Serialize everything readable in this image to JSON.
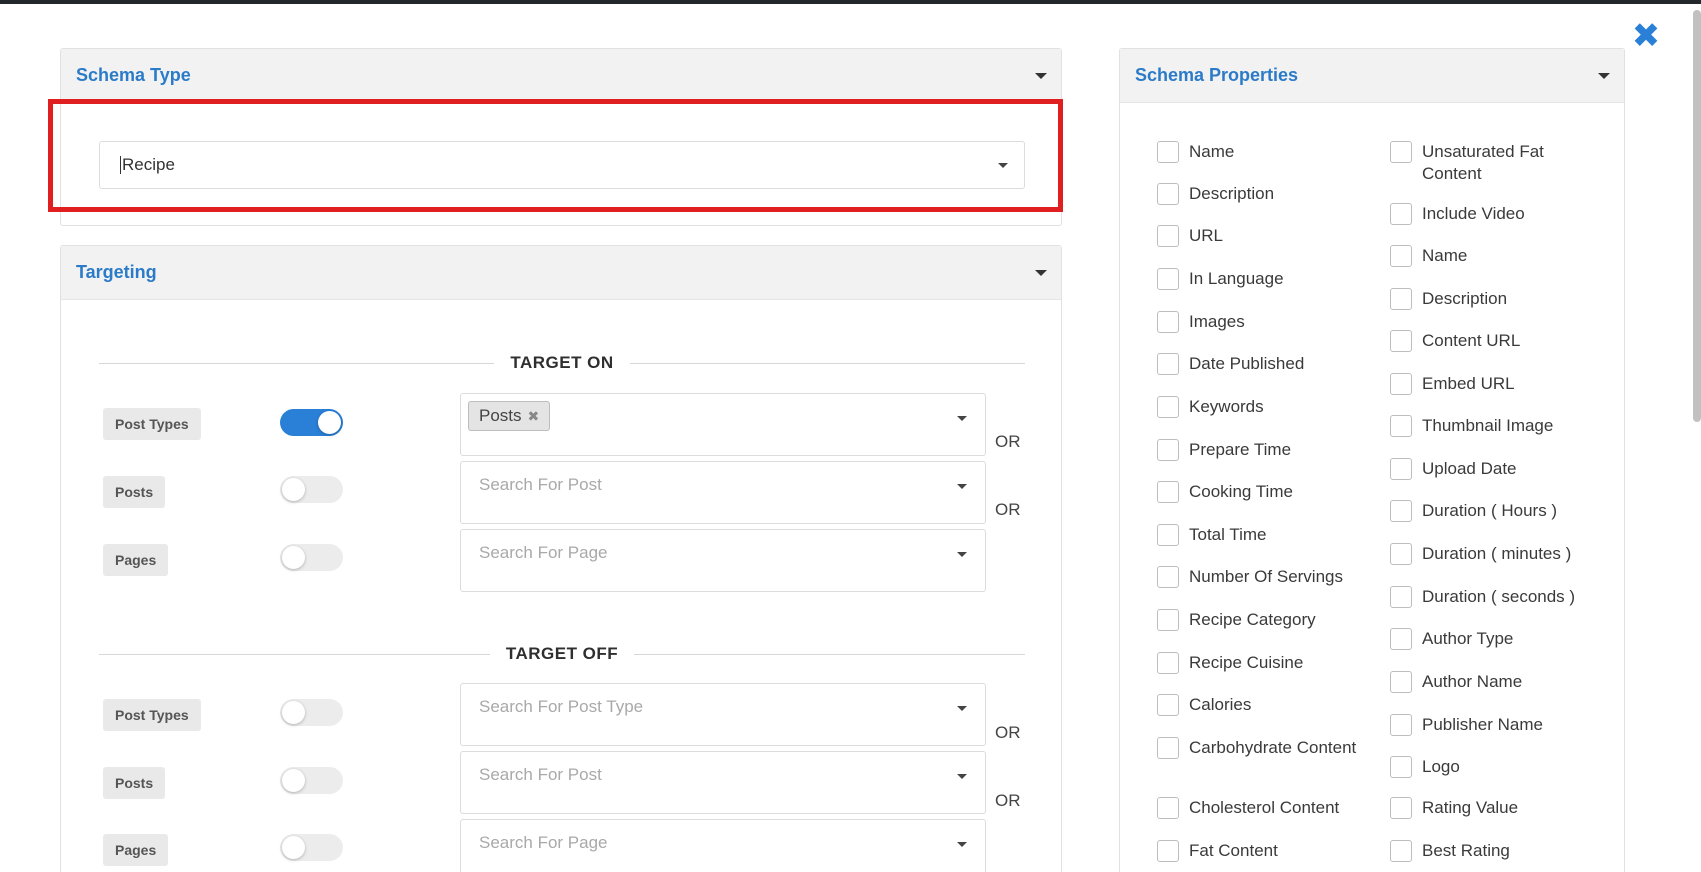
{
  "close_label": "✖",
  "schema_type": {
    "title": "Schema Type",
    "selected": "Recipe"
  },
  "targeting": {
    "title": "Targeting",
    "target_on": {
      "heading": "TARGET ON",
      "rows": [
        {
          "label": "Post Types",
          "toggle_on": true,
          "tag": "Posts",
          "placeholder": "",
          "or": "OR"
        },
        {
          "label": "Posts",
          "toggle_on": false,
          "tag": "",
          "placeholder": "Search For Post",
          "or": "OR"
        },
        {
          "label": "Pages",
          "toggle_on": false,
          "tag": "",
          "placeholder": "Search For Page",
          "or": ""
        }
      ]
    },
    "target_off": {
      "heading": "TARGET OFF",
      "rows": [
        {
          "label": "Post Types",
          "toggle_on": false,
          "placeholder": "Search For Post Type",
          "or": "OR"
        },
        {
          "label": "Posts",
          "toggle_on": false,
          "placeholder": "Search For Post",
          "or": "OR"
        },
        {
          "label": "Pages",
          "toggle_on": false,
          "placeholder": "Search For Page",
          "or": ""
        }
      ]
    }
  },
  "schema_properties": {
    "title": "Schema Properties",
    "col1": [
      "Name",
      "Description",
      "URL",
      "In Language",
      "Images",
      "Date Published",
      "Keywords",
      "Prepare Time",
      "Cooking Time",
      "Total Time",
      "Number Of Servings",
      "Recipe Category",
      "Recipe Cuisine",
      "Calories",
      "Carbohydrate Content",
      "Cholesterol Content",
      "Fat Content"
    ],
    "col2": [
      "Unsaturated Fat Content",
      "Include Video",
      "Name",
      "Description",
      "Content URL",
      "Embed URL",
      "Thumbnail Image",
      "Upload Date",
      "Duration ( Hours )",
      "Duration ( minutes )",
      "Duration ( seconds )",
      "Author Type",
      "Author Name",
      "Publisher Name",
      "Logo",
      "Rating Value",
      "Best Rating"
    ]
  },
  "colors": {
    "accent": "#2a7fd6",
    "highlight": "#e02020"
  }
}
